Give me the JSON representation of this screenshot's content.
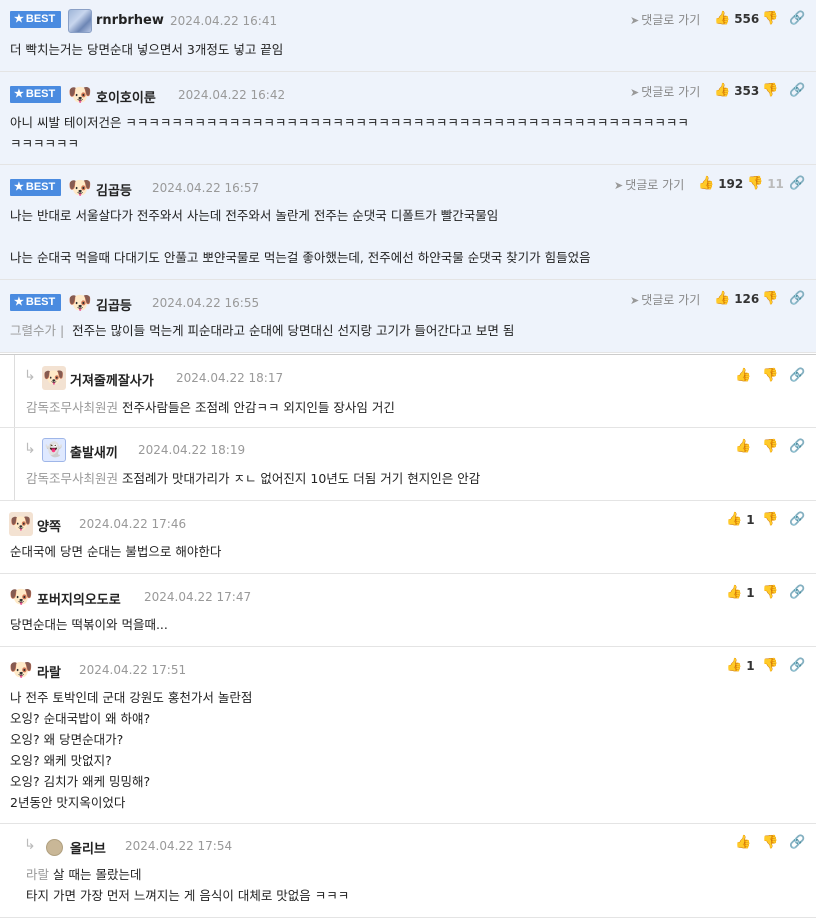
{
  "best_badge": "BEST",
  "goto_label": "댓글로 가기",
  "comments": [
    {
      "nick": "rnrbrhew",
      "date": "2024.04.22 16:41",
      "up": "556",
      "down": "",
      "text": "더 빡치는거는 당면순대 넣으면서 3개정도 넣고 끝임",
      "mention": ""
    },
    {
      "nick": "호이호이룬",
      "date": "2024.04.22 16:42",
      "up": "353",
      "down": "",
      "text": "아니 씨발 테이저건은 ㅋㅋㅋㅋㅋㅋㅋㅋㅋㅋㅋㅋㅋㅋㅋㅋㅋㅋㅋㅋㅋㅋㅋㅋㅋㅋㅋㅋㅋㅋㅋㅋㅋㅋㅋㅋㅋㅋㅋㅋㅋㅋㅋㅋㅋㅋㅋㅋㅋ",
      "text2": "ㅋㅋㅋㅋㅋㅋ",
      "mention": ""
    },
    {
      "nick": "김곱등",
      "date": "2024.04.22 16:57",
      "up": "192",
      "down": "11",
      "text": "나는 반대로 서울살다가 전주와서 사는데 전주와서 놀란게 전주는 순댓국 디폴트가 빨간국물임",
      "text2": "나는 순대국 먹을때 다대기도 안풀고 뽀얀국물로 먹는걸 좋아했는데, 전주에선 하얀국물 순댓국 찾기가 힘들었음",
      "mention": ""
    },
    {
      "nick": "김곱등",
      "date": "2024.04.22 16:55",
      "up": "126",
      "down": "",
      "text": "전주는 많이들 먹는게 피순대라고 순대에 당면대신 선지랑 고기가 들어간다고 보면 됨",
      "mention": "그렬수가 |"
    },
    {
      "nick": "거져줄께잘사가",
      "date": "2024.04.22 18:17",
      "up": "",
      "down": "",
      "text": "전주사람들은 조점례 안감ㅋㅋ 외지인들 장사임 거긴",
      "mention": "감독조무사최원권"
    },
    {
      "nick": "출발새끼",
      "date": "2024.04.22 18:19",
      "up": "",
      "down": "",
      "text": "조점례가 맛대가리가 ㅈㄴ 없어진지 10년도 더됨 거기 현지인은 안감",
      "mention": "감독조무사최원권"
    },
    {
      "nick": "양쪽",
      "date": "2024.04.22 17:46",
      "up": "1",
      "down": "",
      "text": "순대국에 당면 순대는 불법으로 해야한다",
      "mention": ""
    },
    {
      "nick": "포버지의오도로",
      "date": "2024.04.22 17:47",
      "up": "1",
      "down": "",
      "text": "당면순대는 떡볶이와 먹을때...",
      "mention": ""
    },
    {
      "nick": "라랄",
      "date": "2024.04.22 17:51",
      "up": "1",
      "down": "",
      "lines": [
        "나 전주 토박인데 군대 강원도 홍천가서 놀란점",
        "오잉? 순대국밥이 왜 하얘?",
        "오잉? 왜 당면순대가?",
        "오잉? 왜케 맛없지?",
        "오잉? 김치가 왜케 밍밍해?",
        "2년동안 맛지옥이었다"
      ],
      "mention": ""
    },
    {
      "nick": "올리브",
      "date": "2024.04.22 17:54",
      "up": "",
      "down": "",
      "text": "살 때는 몰랐는데",
      "text2": "타지 가면 가장 먼저 느껴지는 게 음식이 대체로 맛없음 ㅋㅋㅋ",
      "mention": "라랄"
    }
  ],
  "icons": {
    "thumb_up": "thumbs-up-icon",
    "thumb_down": "thumbs-down-icon",
    "link": "link-icon",
    "goto": "arrow-icon",
    "reply": "reply-arrow-icon"
  }
}
